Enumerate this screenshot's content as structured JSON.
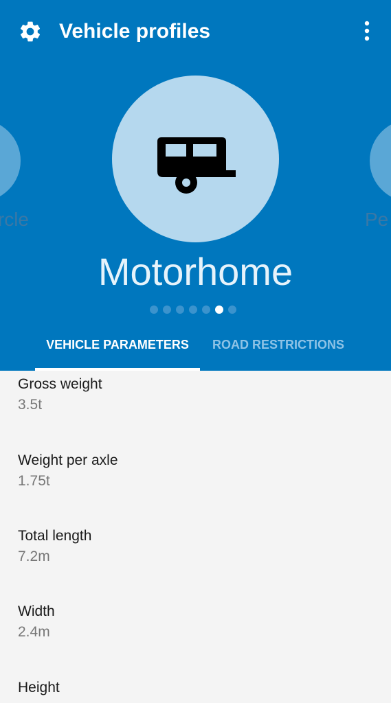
{
  "appbar": {
    "title": "Vehicle profiles"
  },
  "carousel": {
    "prev_label": "Motorcycle",
    "prev_label_visible": "rcle",
    "current_label": "Motorhome",
    "next_label_visible": "Pe",
    "page_count": 7,
    "active_index": 5
  },
  "tabs": [
    {
      "label": "VEHICLE PARAMETERS"
    },
    {
      "label": "ROAD RESTRICTIONS"
    }
  ],
  "parameters": [
    {
      "label": "Gross weight",
      "value": "3.5t"
    },
    {
      "label": "Weight per axle",
      "value": "1.75t"
    },
    {
      "label": "Total length",
      "value": "7.2m"
    },
    {
      "label": "Width",
      "value": "2.4m"
    },
    {
      "label": "Height",
      "value": ""
    }
  ],
  "colors": {
    "header_blue": "#0077be",
    "circle_light": "#b5d8ee",
    "background": "#f4f4f4"
  },
  "icons": [
    "gear-icon",
    "overflow-menu-icon",
    "caravan-icon"
  ]
}
